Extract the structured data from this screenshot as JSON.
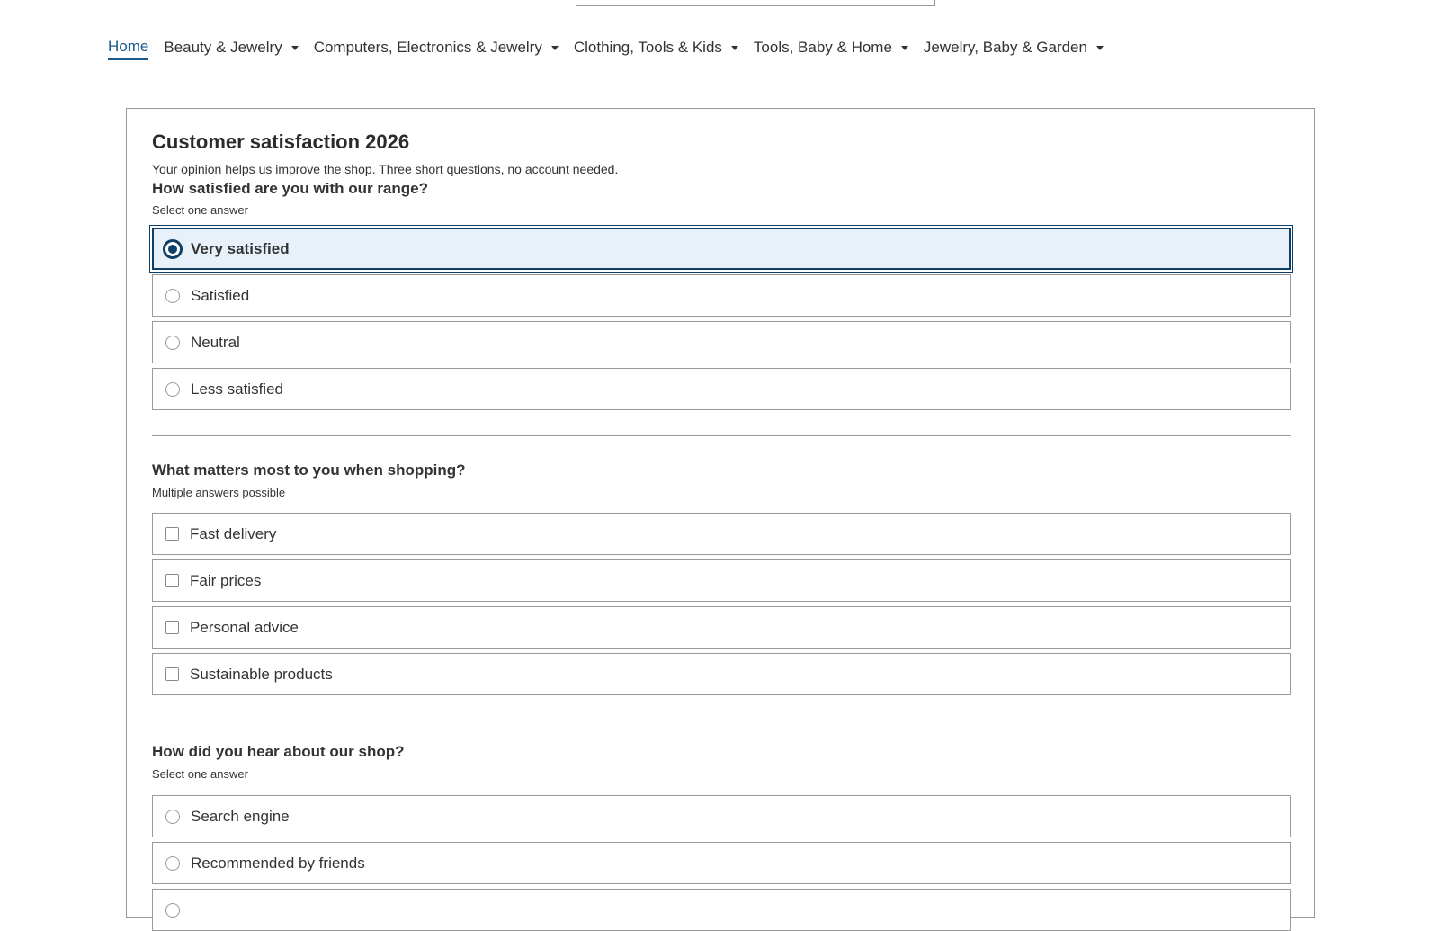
{
  "nav": {
    "items": [
      {
        "label": "Home",
        "active": true,
        "dropdown": false
      },
      {
        "label": "Beauty & Jewelry",
        "active": false,
        "dropdown": true
      },
      {
        "label": "Computers, Electronics & Jewelry",
        "active": false,
        "dropdown": true
      },
      {
        "label": "Clothing, Tools & Kids",
        "active": false,
        "dropdown": true
      },
      {
        "label": "Tools, Baby & Home",
        "active": false,
        "dropdown": true
      },
      {
        "label": "Jewelry, Baby & Garden",
        "active": false,
        "dropdown": true
      }
    ]
  },
  "survey": {
    "title": "Customer satisfaction 2026",
    "intro": "Your opinion helps us improve the shop. Three short questions, no account needed.",
    "questions": [
      {
        "title": "How satisfied are you with our range?",
        "hint": "Select one answer",
        "type": "radio",
        "options": [
          {
            "label": "Very satisfied",
            "checked": true
          },
          {
            "label": "Satisfied",
            "checked": false
          },
          {
            "label": "Neutral",
            "checked": false
          },
          {
            "label": "Less satisfied",
            "checked": false
          }
        ]
      },
      {
        "title": "What matters most to you when shopping?",
        "hint": "Multiple answers possible",
        "type": "checkbox",
        "options": [
          {
            "label": "Fast delivery",
            "checked": false
          },
          {
            "label": "Fair prices",
            "checked": false
          },
          {
            "label": "Personal advice",
            "checked": false
          },
          {
            "label": "Sustainable products",
            "checked": false
          }
        ]
      },
      {
        "title": "How did you hear about our shop?",
        "hint": "Select one answer",
        "type": "radio",
        "options": [
          {
            "label": "Search engine",
            "checked": false
          },
          {
            "label": "Recommended by friends",
            "checked": false
          }
        ]
      }
    ]
  },
  "colors": {
    "accent": "#0f3f66",
    "nav_active": "#1c5a8e",
    "selected_bg": "#e8f1fa",
    "border": "#9a9a9a"
  }
}
